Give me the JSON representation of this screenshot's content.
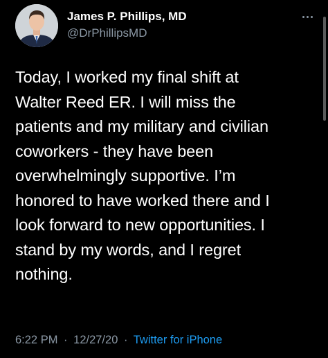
{
  "user": {
    "display_name": "James P. Phillips, MD",
    "handle": "@DrPhillipsMD"
  },
  "tweet": {
    "lines": [
      "Today, I worked my final shift at",
      "Walter Reed ER. I will miss the",
      "patients and my military and civilian",
      "coworkers - they have been",
      "overwhelmingly supportive. I’m",
      "honored to have worked there and I",
      "look forward to new opportunities. I",
      "stand by my words, and I regret",
      "nothing."
    ]
  },
  "meta": {
    "time": "6:22 PM",
    "date": "12/27/20",
    "source": "Twitter for iPhone",
    "separator": "·"
  },
  "icons": {
    "more": "more-options-icon"
  },
  "colors": {
    "background": "#000000",
    "text": "#ffffff",
    "secondary": "#8b98a5",
    "link": "#1d9bf0"
  }
}
